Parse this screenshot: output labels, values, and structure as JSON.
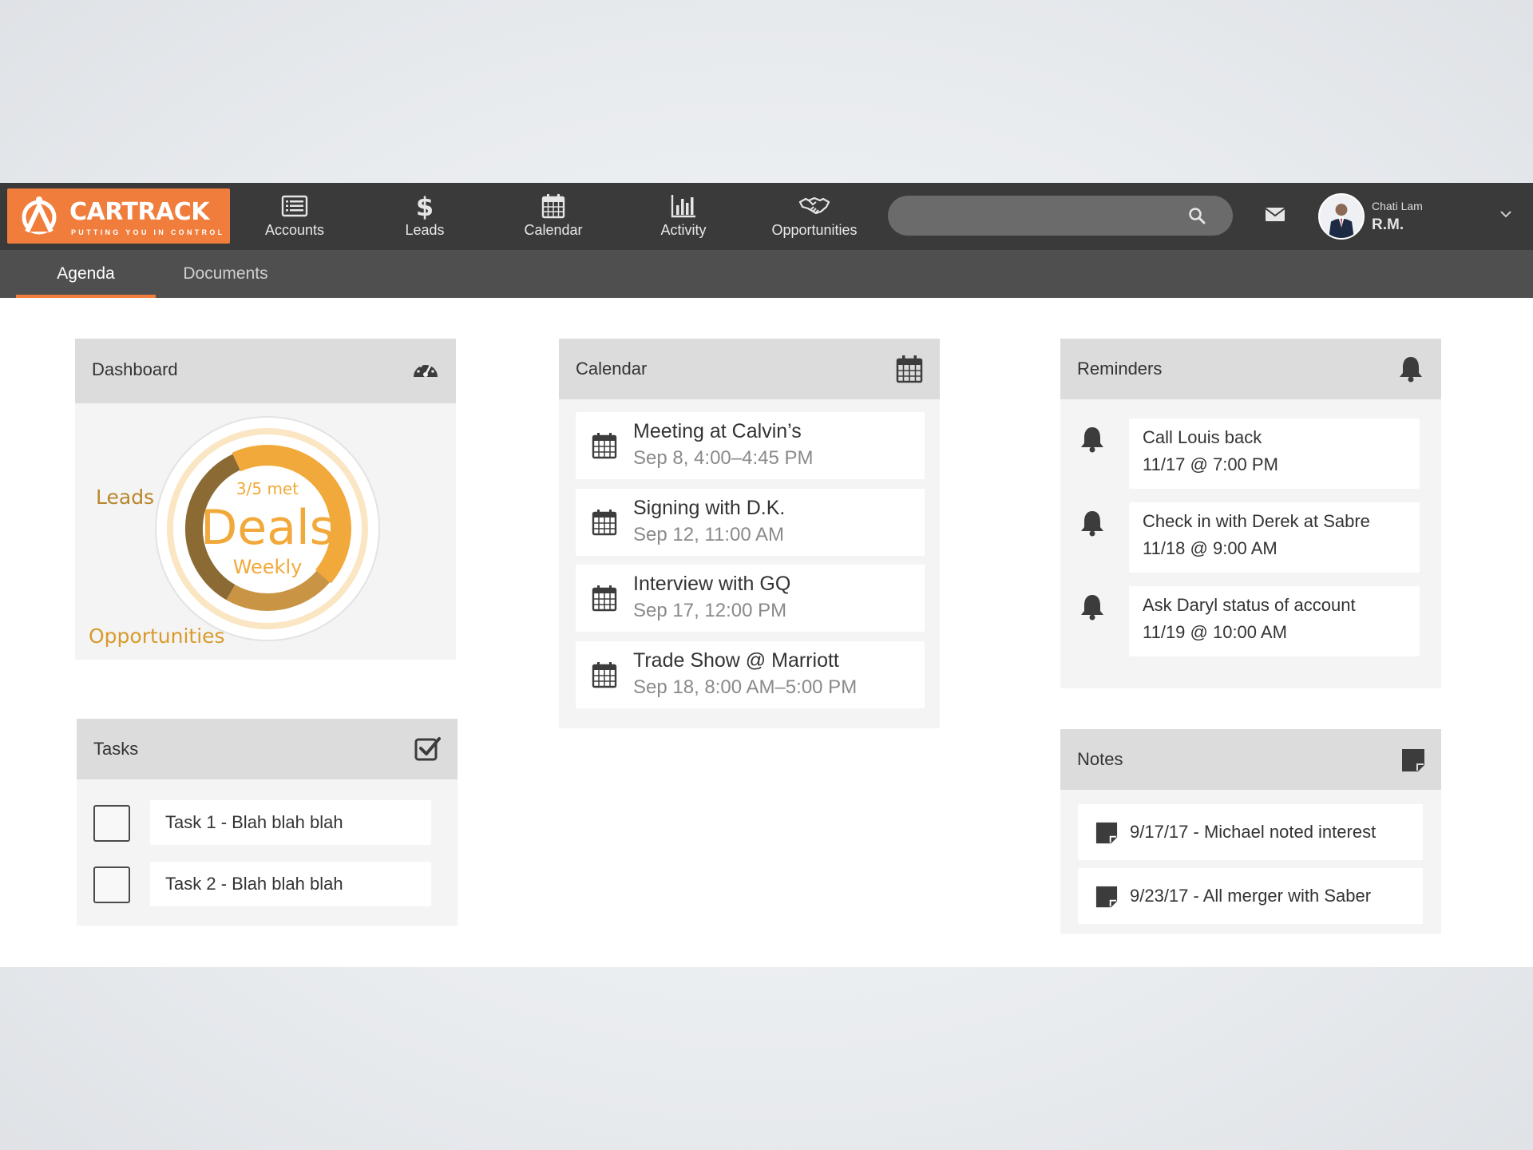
{
  "brand": {
    "name": "CARTRACK",
    "tagline": "PUTTING YOU IN CONTROL",
    "color": "#f07d3c"
  },
  "nav": {
    "items": [
      {
        "label": "Accounts",
        "icon": "list-icon"
      },
      {
        "label": "Leads",
        "icon": "dollar-icon"
      },
      {
        "label": "Calendar",
        "icon": "calendar-icon"
      },
      {
        "label": "Activity",
        "icon": "bar-chart-icon"
      },
      {
        "label": "Opportunities",
        "icon": "handshake-icon"
      }
    ]
  },
  "search": {
    "placeholder": "",
    "value": ""
  },
  "user": {
    "name": "Chati Lam",
    "initials": "R.M."
  },
  "tabs": [
    {
      "label": "Agenda",
      "active": true
    },
    {
      "label": "Documents",
      "active": false
    }
  ],
  "dashboard": {
    "title": "Dashboard",
    "ring": {
      "top_text": "3/5 met",
      "center_text": "Deals",
      "bottom_text": "Weekly",
      "deals_met": 3,
      "deals_goal": 5
    },
    "label_leads": "Leads",
    "label_opportunities": "Opportunities",
    "colors": {
      "orange": "#f2a93b",
      "brown": "#8b6a34",
      "tan": "#c99545",
      "label": "#b8862b"
    }
  },
  "tasks": {
    "title": "Tasks",
    "items": [
      {
        "label": "Task 1 - Blah blah blah",
        "checked": false
      },
      {
        "label": "Task 2 - Blah blah blah",
        "checked": false
      }
    ]
  },
  "calendar": {
    "title": "Calendar",
    "events": [
      {
        "title": "Meeting at Calvin’s",
        "time": "Sep 8, 4:00–4:45 PM"
      },
      {
        "title": "Signing with D.K.",
        "time": "Sep 12, 11:00 AM"
      },
      {
        "title": "Interview with GQ",
        "time": "Sep 17, 12:00 PM"
      },
      {
        "title": "Trade Show @ Marriott",
        "time": "Sep 18, 8:00 AM–5:00 PM"
      }
    ]
  },
  "reminders": {
    "title": "Reminders",
    "items": [
      {
        "text": "Call Louis back",
        "date": "11/17 @ 7:00 PM"
      },
      {
        "text": "Check in with Derek at Sabre",
        "date": "11/18 @ 9:00 AM"
      },
      {
        "text": "Ask Daryl status of account",
        "date": "11/19 @ 10:00 AM"
      }
    ]
  },
  "notes": {
    "title": "Notes",
    "items": [
      {
        "text": "9/17/17 - Michael noted interest"
      },
      {
        "text": "9/23/17 - All merger with Saber"
      }
    ]
  }
}
